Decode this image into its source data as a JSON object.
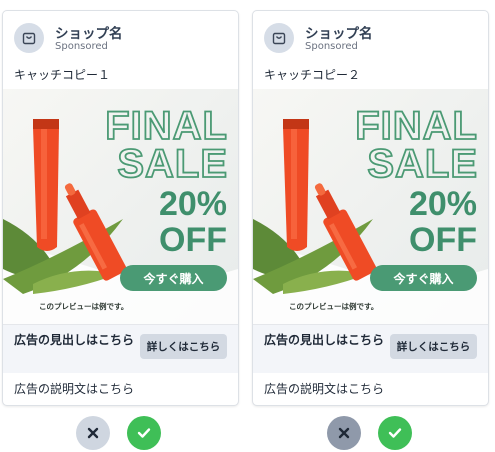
{
  "cards": [
    {
      "shop_name": "ショップ名",
      "sponsored": "Sponsored",
      "catch_copy": "キャッチコピー１",
      "ad": {
        "line1": "FINAL",
        "line2": "SALE",
        "discount": "20%",
        "off": "OFF",
        "cta": "今すぐ購入",
        "note": "このプレビューは例です。"
      },
      "headline": "広告の見出しはこちら",
      "detail_button": "詳しくはこちら",
      "description": "広告の説明文はこちら"
    },
    {
      "shop_name": "ショップ名",
      "sponsored": "Sponsored",
      "catch_copy": "キャッチコピー２",
      "ad": {
        "line1": "FINAL",
        "line2": "SALE",
        "discount": "20%",
        "off": "OFF",
        "cta": "今すぐ購入",
        "note": "このプレビューは例です。"
      },
      "headline": "広告の見出しはこちら",
      "detail_button": "詳しくはこちら",
      "description": "広告の説明文はこちら"
    }
  ],
  "actions": {
    "left": {
      "reject_icon": "close-icon",
      "approve_icon": "check-icon"
    },
    "right": {
      "reject_icon": "close-icon",
      "approve_icon": "check-icon"
    }
  },
  "colors": {
    "accent_green": "#3f8f6c",
    "approve_green": "#3fbf57",
    "reject_light": "#cfd6e0",
    "reject_active": "#8f99aa",
    "product_orange": "#ef4b25"
  }
}
